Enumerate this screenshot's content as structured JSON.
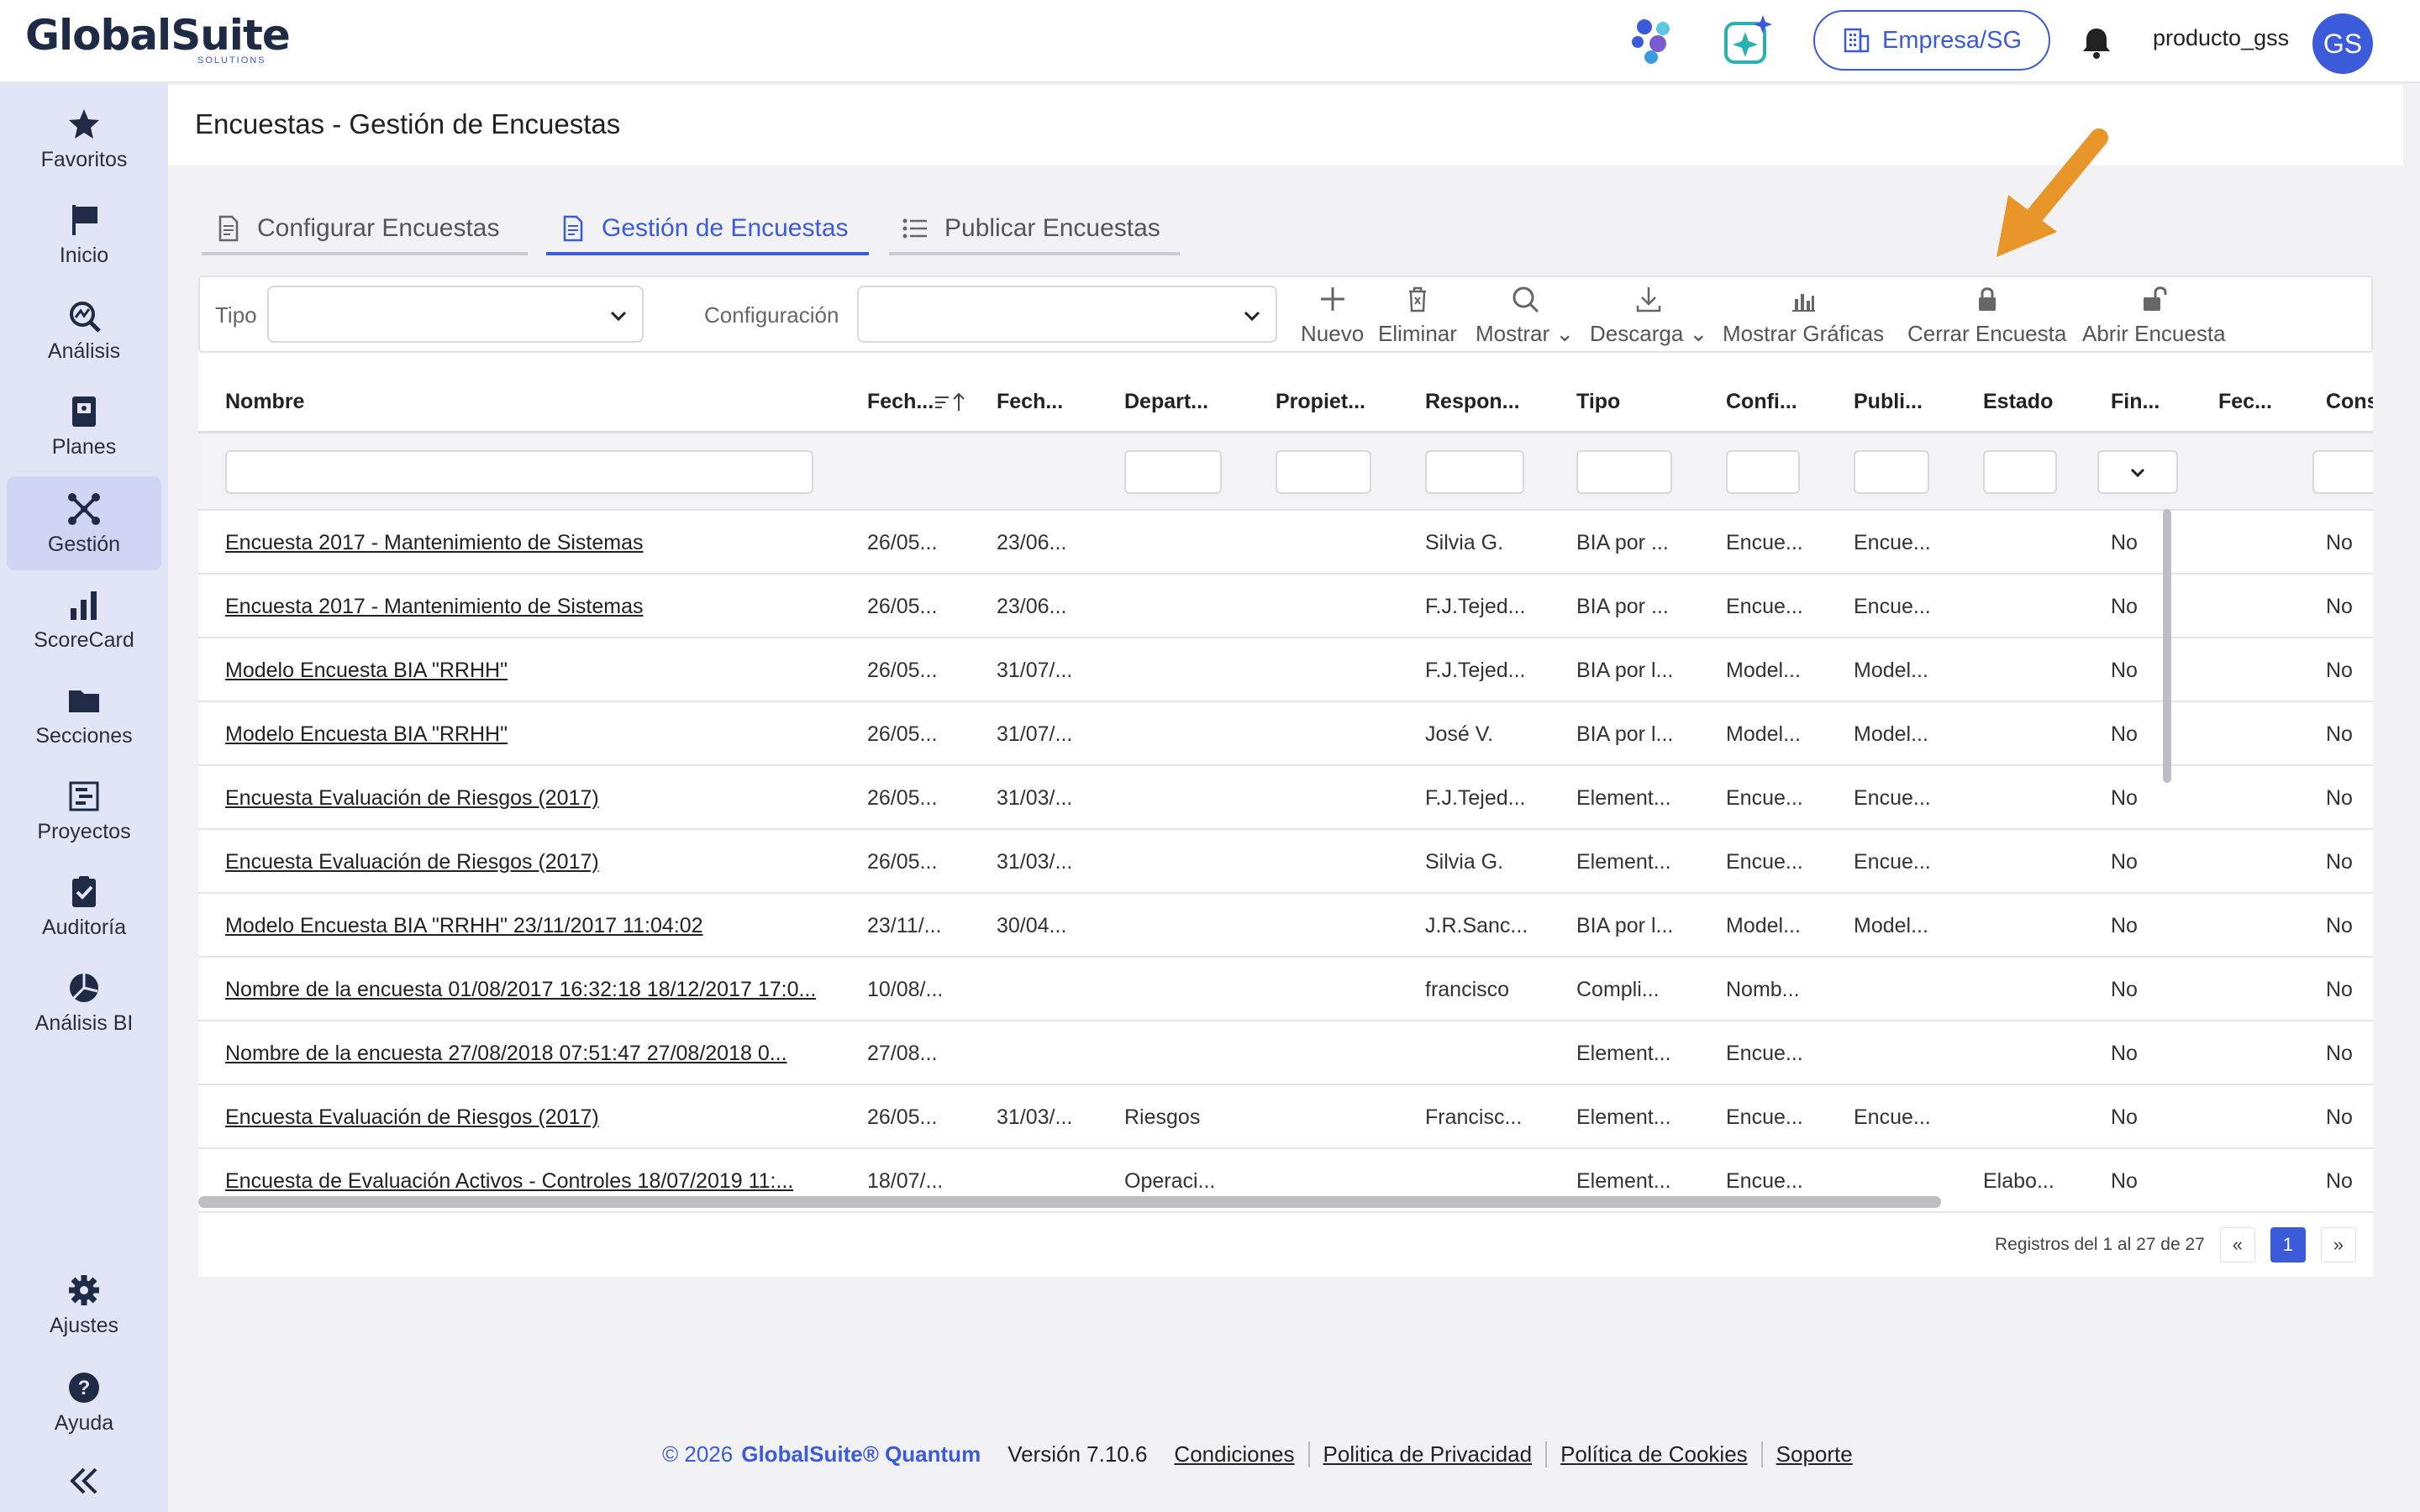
{
  "header": {
    "logo_text": "GlobalSuite",
    "logo_sub": "SOLUTIONS",
    "company_label": "Empresa/SG",
    "username": "producto_gss",
    "avatar_initials": "GS",
    "icons": [
      "network-icon",
      "ai-sparkle-icon",
      "building-icon",
      "bell-icon"
    ]
  },
  "sidebar": {
    "items": [
      {
        "label": "Favoritos",
        "icon": "star-icon"
      },
      {
        "label": "Inicio",
        "icon": "flag-icon"
      },
      {
        "label": "Análisis",
        "icon": "analysis-icon"
      },
      {
        "label": "Planes",
        "icon": "plans-icon"
      },
      {
        "label": "Gestión",
        "icon": "management-icon",
        "active": true
      },
      {
        "label": "ScoreCard",
        "icon": "bar-chart-icon"
      },
      {
        "label": "Secciones",
        "icon": "folder-icon"
      },
      {
        "label": "Proyectos",
        "icon": "projects-icon"
      },
      {
        "label": "Auditoría",
        "icon": "clipboard-check-icon"
      },
      {
        "label": "Análisis BI",
        "icon": "pie-chart-icon"
      }
    ],
    "bottom_items": [
      {
        "label": "Ajustes",
        "icon": "gear-icon"
      },
      {
        "label": "Ayuda",
        "icon": "help-icon"
      }
    ],
    "collapse_icon": "double-chevron-left-icon"
  },
  "page": {
    "title": "Encuestas  - Gestión de Encuestas"
  },
  "tabs": [
    {
      "label": "Configurar Encuestas",
      "icon": "document-icon"
    },
    {
      "label": "Gestión de Encuestas",
      "icon": "document-icon",
      "active": true
    },
    {
      "label": "Publicar Encuestas",
      "icon": "list-icon"
    }
  ],
  "filters": {
    "tipo_label": "Tipo",
    "tipo_value": "",
    "config_label": "Configuración",
    "config_value": ""
  },
  "toolbar": {
    "nuevo": "Nuevo",
    "eliminar": "Eliminar",
    "mostrar": "Mostrar",
    "descarga": "Descarga",
    "mostrar_graficas": "Mostrar Gráficas",
    "cerrar_encuesta": "Cerrar Encuesta",
    "abrir_encuesta": "Abrir Encuesta"
  },
  "table": {
    "columns": [
      "Nombre",
      "Fech...",
      "Fech...",
      "Depart...",
      "Propiet...",
      "Respon...",
      "Tipo",
      "Confi...",
      "Publi...",
      "Estado",
      "Fin...",
      "Fec...",
      "Cons"
    ],
    "rows": [
      [
        "Encuesta 2017 - Mantenimiento de Sistemas",
        "26/05...",
        "23/06...",
        "",
        "",
        "Silvia G.",
        "BIA por ...",
        "Encue...",
        "Encue...",
        "",
        "No",
        "",
        "No"
      ],
      [
        "Encuesta 2017 - Mantenimiento de Sistemas",
        "26/05...",
        "23/06...",
        "",
        "",
        "F.J.Tejed...",
        "BIA por ...",
        "Encue...",
        "Encue...",
        "",
        "No",
        "",
        "No"
      ],
      [
        "Modelo Encuesta BIA \"RRHH\"",
        "26/05...",
        "31/07/...",
        "",
        "",
        "F.J.Tejed...",
        "BIA por l...",
        "Model...",
        "Model...",
        "",
        "No",
        "",
        "No"
      ],
      [
        "Modelo Encuesta BIA \"RRHH\"",
        "26/05...",
        "31/07/...",
        "",
        "",
        "José V.",
        "BIA por l...",
        "Model...",
        "Model...",
        "",
        "No",
        "",
        "No"
      ],
      [
        "Encuesta Evaluación de Riesgos (2017)",
        "26/05...",
        "31/03/...",
        "",
        "",
        "F.J.Tejed...",
        "Element...",
        "Encue...",
        "Encue...",
        "",
        "No",
        "",
        "No"
      ],
      [
        "Encuesta Evaluación de Riesgos (2017)",
        "26/05...",
        "31/03/...",
        "",
        "",
        "Silvia G.",
        "Element...",
        "Encue...",
        "Encue...",
        "",
        "No",
        "",
        "No"
      ],
      [
        "Modelo Encuesta BIA \"RRHH\" 23/11/2017 11:04:02",
        "23/11/...",
        "30/04...",
        "",
        "",
        "J.R.Sanc...",
        "BIA por l...",
        "Model...",
        "Model...",
        "",
        "No",
        "",
        "No"
      ],
      [
        "Nombre de la encuesta 01/08/2017 16:32:18 18/12/2017 17:0...",
        "10/08/...",
        "",
        "",
        "",
        "francisco",
        "Compli...",
        "Nomb...",
        "",
        "",
        "No",
        "",
        "No"
      ],
      [
        "Nombre de la encuesta 27/08/2018 07:51:47 27/08/2018 0...",
        "27/08...",
        "",
        "",
        "",
        "",
        "Element...",
        "Encue...",
        "",
        "",
        "No",
        "",
        "No"
      ],
      [
        "Encuesta Evaluación de Riesgos (2017)",
        "26/05...",
        "31/03/...",
        "Riesgos",
        "",
        "Francisc...",
        "Element...",
        "Encue...",
        "Encue...",
        "",
        "No",
        "",
        "No"
      ],
      [
        "Encuesta de Evaluación Activos - Controles 18/07/2019 11:...",
        "18/07/...",
        "",
        "Operaci...",
        "",
        "",
        "Element...",
        "Encue...",
        "",
        "Elabo...",
        "No",
        "",
        "No"
      ]
    ]
  },
  "pager": {
    "info": "Registros del 1 al 27 de 27",
    "prev": "«",
    "page": "1",
    "next": "»"
  },
  "footer": {
    "copyright": "© 2026",
    "brand": "GlobalSuite® Quantum",
    "version": "Versión 7.10.6",
    "links": [
      "Condiciones",
      "Politica de Privacidad",
      "Política de Cookies",
      "Soporte"
    ]
  },
  "colors": {
    "accent": "#3b5bdb",
    "sidebar_bg": "#e2e5f6",
    "arrow": "#e8952a"
  }
}
